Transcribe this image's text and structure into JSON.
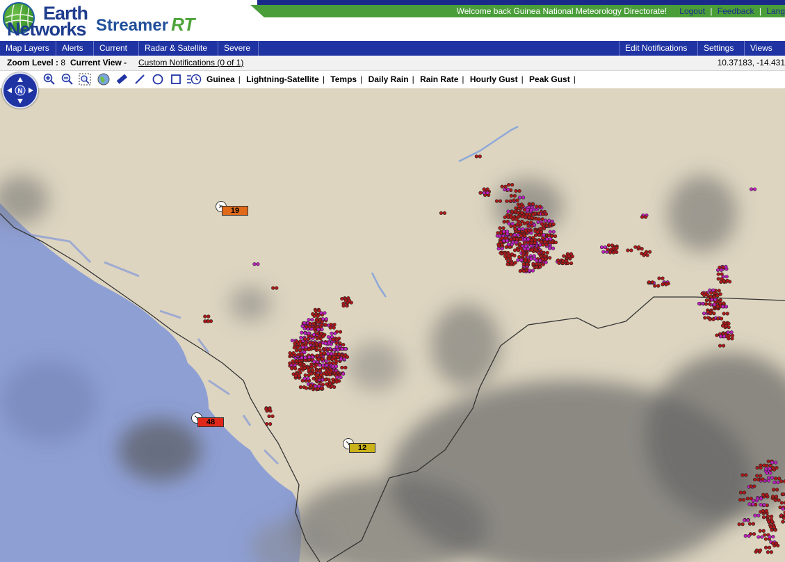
{
  "brand": {
    "logo_line1": "Earth",
    "logo_line2": "Networks",
    "product": "Streamer",
    "product_suffix": "RT"
  },
  "welcome": {
    "text": "Welcome back  Guinea National Meteorology Directorate!",
    "logout": "Logout",
    "feedback": "Feedback",
    "language": "Lang"
  },
  "menu": {
    "left": [
      "Map Layers",
      "Alerts",
      "Current",
      "Radar & Satellite",
      "Severe"
    ],
    "right": [
      "Edit Notifications",
      "Settings",
      "Views"
    ]
  },
  "status": {
    "zoom_label": "Zoom Level :",
    "zoom_value": "8",
    "view_label": "Current View -",
    "custom_notifications": "Custom Notifications (0 of 1)",
    "coords": "10.37183, -14.431"
  },
  "toolbar": {
    "tools": [
      "zoom-in-icon",
      "zoom-out-icon",
      "zoom-box-icon",
      "globe-icon",
      "ruler-icon",
      "line-icon",
      "circle-icon",
      "rectangle-icon",
      "time-icon"
    ],
    "layers": [
      "Guinea",
      "Lightning-Satellite",
      "Temps",
      "Daily Rain",
      "Rain Rate",
      "Hourly Gust",
      "Peak Gust"
    ]
  },
  "gusts": [
    {
      "value": "19",
      "color": "#e06a1a"
    },
    {
      "value": "48",
      "color": "#e0281a"
    },
    {
      "value": "12",
      "color": "#c9b21a"
    }
  ],
  "colors": {
    "accent_blue": "#1f33a3",
    "brand_green": "#4a9e3a",
    "ocean": "#8fa0d4",
    "land": "#e0d8c4",
    "lightning_red": "#b01818",
    "lightning_magenta": "#c020c0"
  }
}
